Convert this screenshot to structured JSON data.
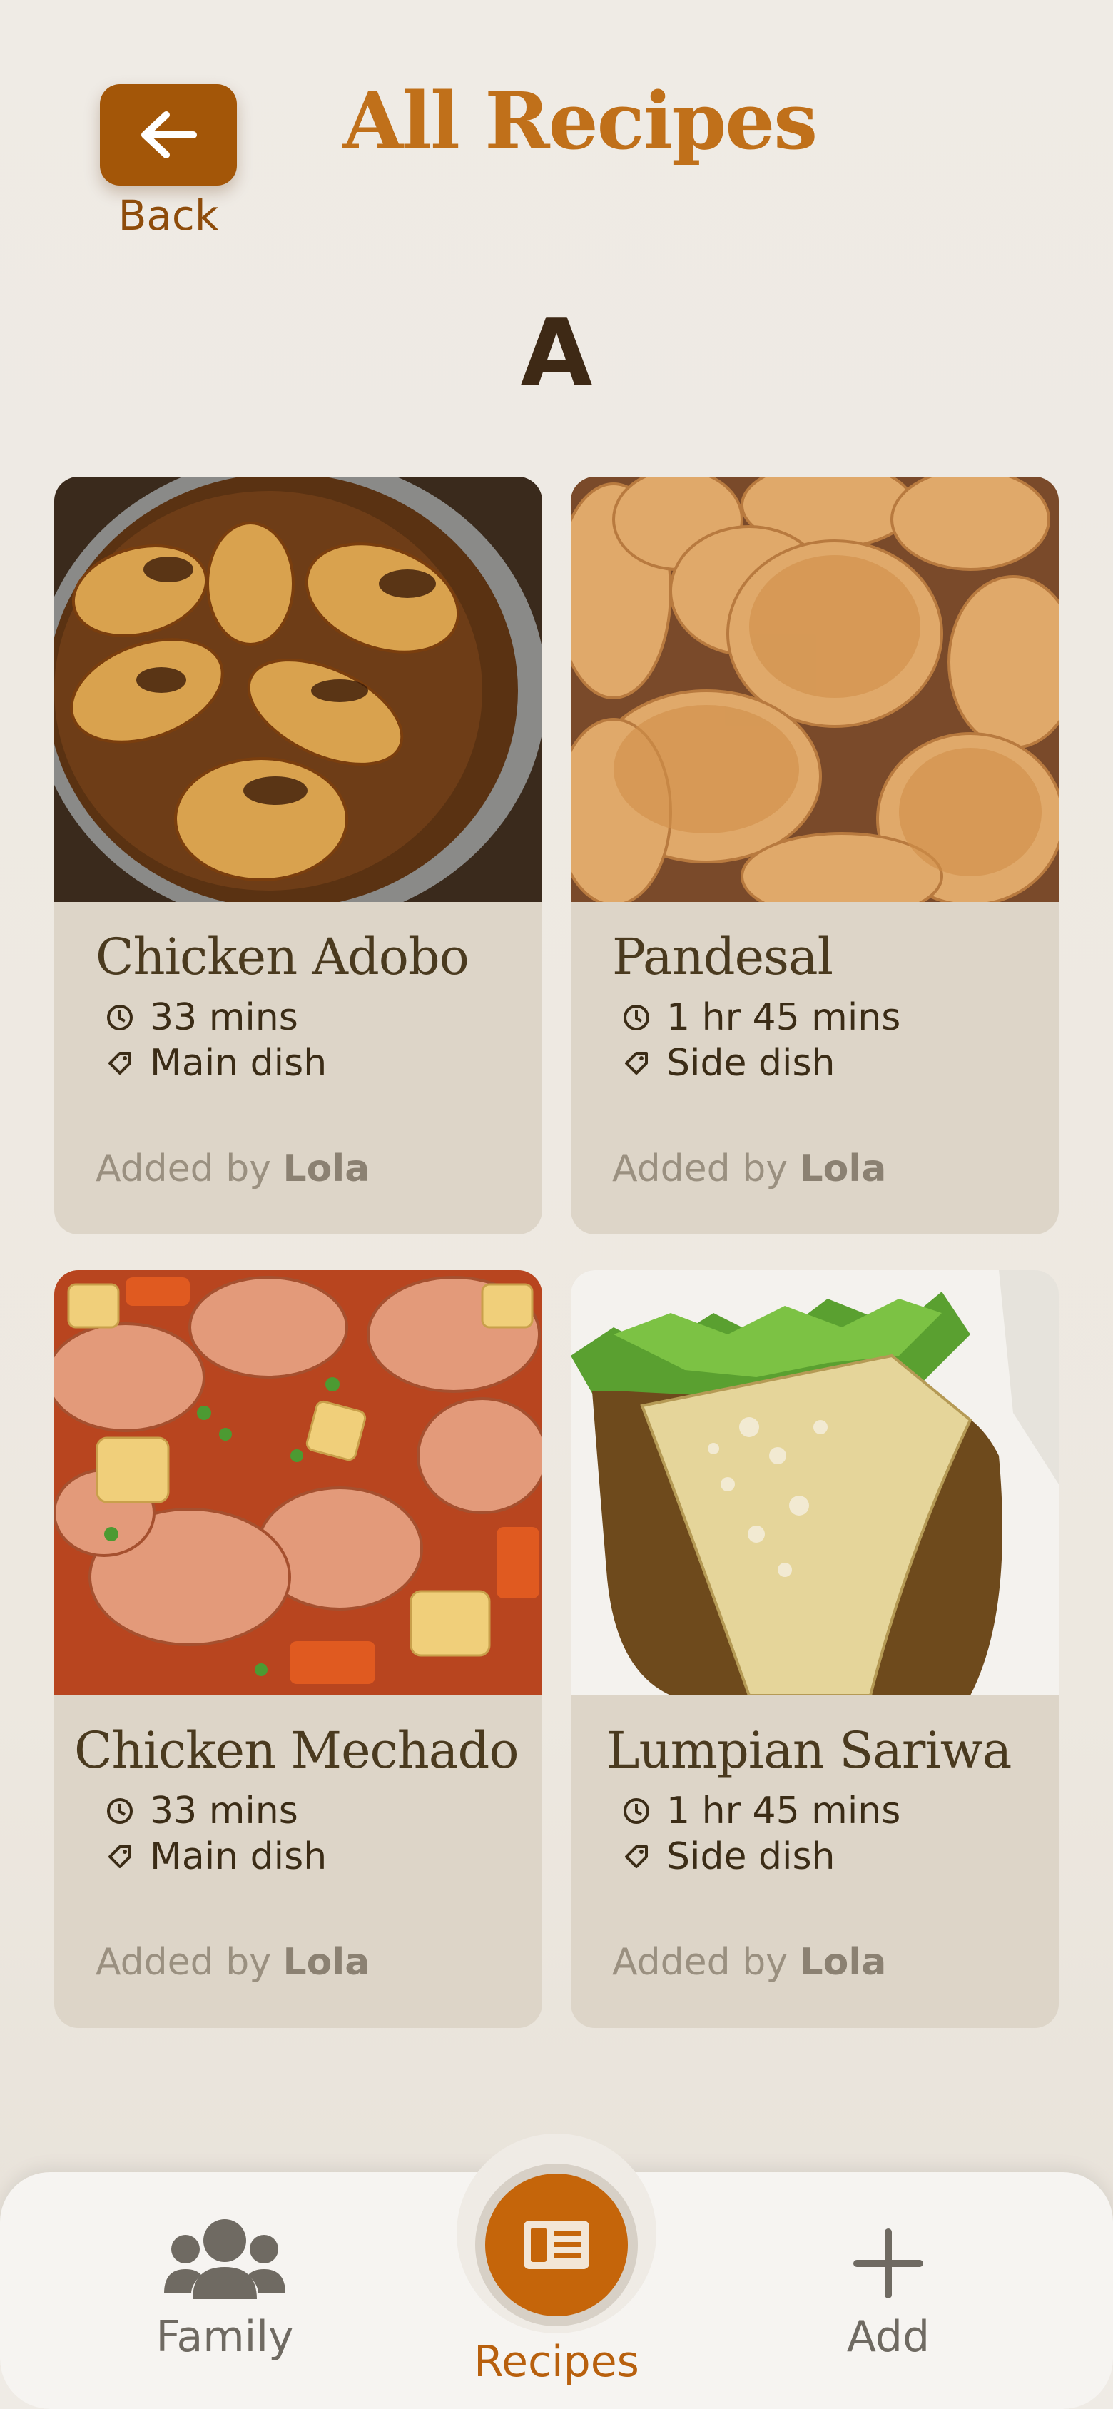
{
  "header": {
    "back_label": "Back",
    "title": "All Recipes"
  },
  "section": {
    "letter": "A"
  },
  "recipes": [
    {
      "name": "Chicken Adobo",
      "time": "33 mins",
      "category": "Main dish",
      "added_prefix": "Added by ",
      "author": "Lola"
    },
    {
      "name": "Pandesal",
      "time": "1 hr 45 mins",
      "category": "Side dish",
      "added_prefix": "Added by ",
      "author": "Lola"
    },
    {
      "name": "Chicken Mechado",
      "time": "33 mins",
      "category": "Main dish",
      "added_prefix": "Added by ",
      "author": "Lola"
    },
    {
      "name": "Lumpian Sariwa",
      "time": "1 hr 45 mins",
      "category": "Side dish",
      "added_prefix": "Added by ",
      "author": "Lola"
    }
  ],
  "nav": {
    "family_label": "Family",
    "recipes_label": "Recipes",
    "add_label": "Add"
  },
  "colors": {
    "accent": "#c5650a",
    "back_button": "#a35608",
    "title": "#c0701a",
    "card": "#ddd5c8",
    "active_nav": "#b8600e",
    "inactive_nav": "#6f6a62"
  },
  "icons": {
    "back": "arrow-left-icon",
    "time": "clock-icon",
    "category": "tag-icon",
    "family": "people-icon",
    "recipes": "recipe-book-icon",
    "add": "plus-icon"
  }
}
